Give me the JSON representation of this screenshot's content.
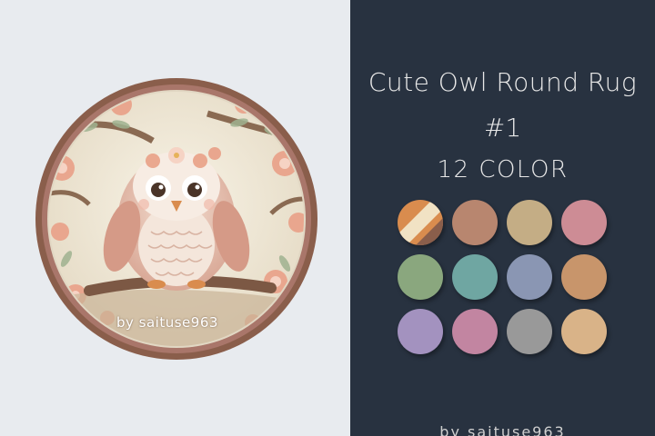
{
  "product": {
    "title": "Cute Owl Round Rug",
    "number": "#1",
    "color_count": "12 COLOR",
    "watermark": "by saituse963",
    "footer": "by saituse963"
  },
  "colors": {
    "left_bg": "#e8ebef",
    "right_bg": "#283240",
    "rug_border": "#8a5e4b",
    "rug_center": "#f3ecdd"
  },
  "swatches": [
    {
      "name": "original-multi",
      "color": "#d98c4e"
    },
    {
      "name": "brown",
      "color": "#b8866f"
    },
    {
      "name": "tan",
      "color": "#c4ad85"
    },
    {
      "name": "pink",
      "color": "#cd8c95"
    },
    {
      "name": "green",
      "color": "#8aa77e"
    },
    {
      "name": "teal",
      "color": "#6fa6a2"
    },
    {
      "name": "blue",
      "color": "#8a96b3"
    },
    {
      "name": "caramel",
      "color": "#c8956b"
    },
    {
      "name": "lavender",
      "color": "#a392bf"
    },
    {
      "name": "rose",
      "color": "#c285a1"
    },
    {
      "name": "gray",
      "color": "#999999"
    },
    {
      "name": "sand",
      "color": "#d9b388"
    }
  ]
}
